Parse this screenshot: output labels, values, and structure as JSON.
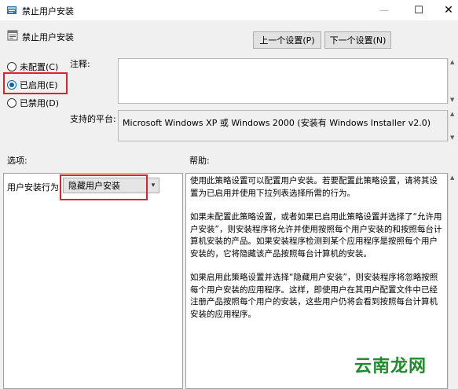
{
  "window": {
    "title": "禁止用户安装"
  },
  "policy": {
    "name": "禁止用户安装"
  },
  "nav": {
    "prev_label": "上一个设置(P)",
    "next_label": "下一个设置(N)"
  },
  "state": {
    "options": [
      {
        "label": "未配置(C)",
        "checked": false
      },
      {
        "label": "已启用(E)",
        "checked": true
      },
      {
        "label": "已禁用(D)",
        "checked": false
      }
    ]
  },
  "comment": {
    "label": "注释:",
    "value": ""
  },
  "platform": {
    "label": "支持的平台:",
    "value": "Microsoft Windows XP 或 Windows 2000 (安装有 Windows Installer v2.0)"
  },
  "options_section": {
    "label": "选项:",
    "field_label": "用户安装行为:",
    "selected": "隐藏用户安装"
  },
  "help_section": {
    "label": "帮助:",
    "paragraphs": [
      "使用此策略设置可以配置用户安装。若要配置此策略设置，请将其设置为已启用并使用下拉列表选择所需的行为。",
      "如果未配置此策略设置，或者如果已启用此策略设置并选择了“允许用户安装”，则安装程序将允许并使用按照每个用户安装的和按照每台计算机安装的产品。如果安装程序检测到某个应用程序是按照每个用户安装的，它将隐藏该产品按照每台计算机的安装。",
      "如果启用此策略设置并选择“隐藏用户安装”，则安装程序将忽略按照每个用户安装的应用程序。这样，即使用户在其用户配置文件中已经注册产品按照每个用户的安装，这些用户仍将会看到按照每台计算机安装的应用程序。"
    ]
  },
  "watermark": {
    "text": "云南龙网"
  },
  "colors": {
    "highlight": "#e0202a",
    "radio_selected": "#0063b1",
    "watermark": "#1f8b2a"
  }
}
